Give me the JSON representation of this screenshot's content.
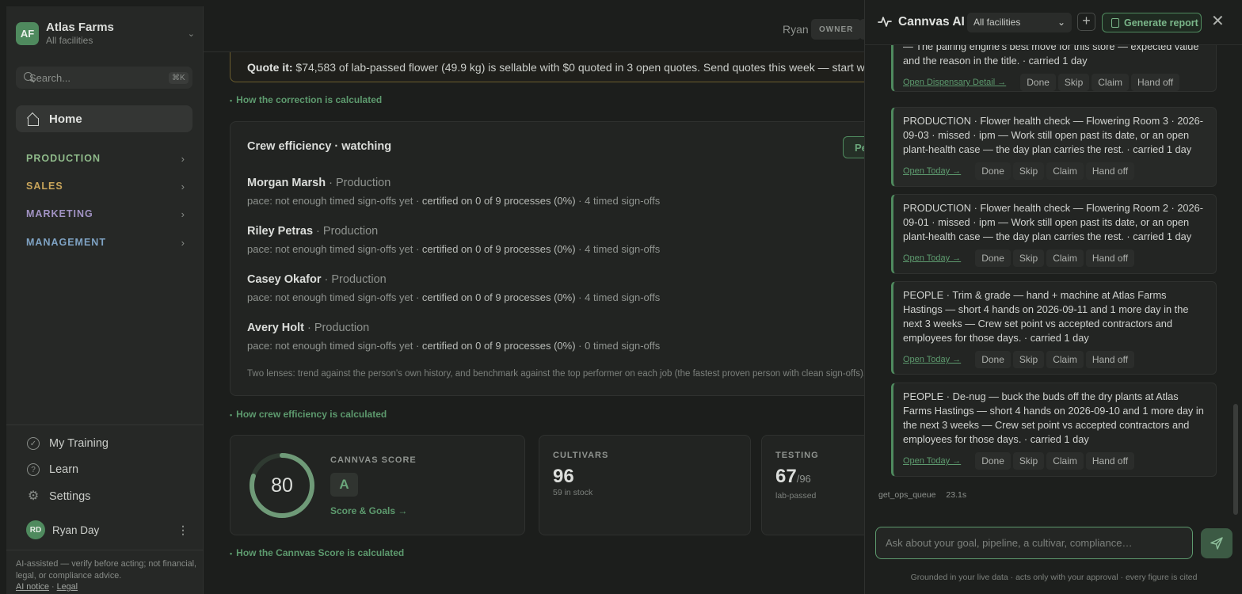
{
  "sidebar": {
    "org": {
      "initials": "AF",
      "name": "Atlas Farms",
      "subtitle": "All facilities"
    },
    "search": {
      "placeholder": "Search...",
      "shortcut": "⌘K"
    },
    "home_label": "Home",
    "sections": [
      {
        "label": "PRODUCTION",
        "color": "#8fba8a"
      },
      {
        "label": "SALES",
        "color": "#c9a55a"
      },
      {
        "label": "MARKETING",
        "color": "#a293c4"
      },
      {
        "label": "MANAGEMENT",
        "color": "#7fa3c4"
      }
    ],
    "bottom": {
      "training": "My Training",
      "learn": "Learn",
      "settings": "Settings"
    },
    "user": {
      "initials": "RD",
      "name": "Ryan Day"
    },
    "disclaimer": "AI-assisted — verify before acting; not financial, legal, or compliance advice.",
    "links": {
      "ai_notice": "AI notice",
      "sep": "·",
      "legal": "Legal"
    }
  },
  "topbar": {
    "user": "Ryan",
    "role": "OWNER"
  },
  "quote": {
    "lead": "Quote it:",
    "text": " $74,583 of lab-passed flower (49.9 kg) is sellable with $0 quoted in 3 open quotes. Send quotes this week — start with t"
  },
  "links": {
    "correction": "How the correction is calculated",
    "crew": "How crew efficiency is calculated",
    "score": "How the Cannvas Score is calculated"
  },
  "crew": {
    "title": "Crew efficiency · watching",
    "button": "Pe",
    "people": [
      {
        "name": "Morgan Marsh",
        "dept": " · Production",
        "pace": "pace: not enough timed sign-offs yet · ",
        "cert": "certified on 0 of 9 processes (0%)",
        "signoffs": " · 4 timed sign-offs"
      },
      {
        "name": "Riley Petras",
        "dept": " · Production",
        "pace": "pace: not enough timed sign-offs yet · ",
        "cert": "certified on 0 of 9 processes (0%)",
        "signoffs": " · 4 timed sign-offs"
      },
      {
        "name": "Casey Okafor",
        "dept": " · Production",
        "pace": "pace: not enough timed sign-offs yet · ",
        "cert": "certified on 0 of 9 processes (0%)",
        "signoffs": " · 4 timed sign-offs"
      },
      {
        "name": "Avery Holt",
        "dept": " · Production",
        "pace": "pace: not enough timed sign-offs yet · ",
        "cert": "certified on 0 of 9 processes (0%)",
        "signoffs": " · 0 timed sign-offs"
      }
    ],
    "note": "Two lenses: trend against the person's own history, and benchmark against the top performer on each job (the fastest proven person with clean sign-offs)."
  },
  "score_card": {
    "value": 80,
    "progress": 0.8,
    "label": "CANNVAS SCORE",
    "grade": "A",
    "goals_link": "Score & Goals →"
  },
  "cultivars_card": {
    "label": "CULTIVARS",
    "value": "96",
    "sub": "59 in stock"
  },
  "testing_card": {
    "label": "TESTING",
    "value": "67",
    "of": "/96",
    "sub": "lab-passed"
  },
  "panel": {
    "title": "Cannvas AI",
    "facility": "All facilities",
    "generate": "Generate report",
    "items": [
      {
        "text": "— The pairing engine's best move for this store — expected value and the reason in the title. · carried 1 day",
        "link": "Open Dispensary Detail →"
      },
      {
        "text": "PRODUCTION · Flower health check — Flowering Room 3 · 2026-09-03 · missed · ipm — Work still open past its date, or an open plant-health case — the day plan carries the rest. · carried 1 day",
        "link": "Open Today →"
      },
      {
        "text": "PRODUCTION · Flower health check — Flowering Room 2 · 2026-09-01 · missed · ipm — Work still open past its date, or an open plant-health case — the day plan carries the rest. · carried 1 day",
        "link": "Open Today →"
      },
      {
        "text": "PEOPLE · Trim & grade — hand + machine at Atlas Farms Hastings — short 4 hands on 2026-09-11 and 1 more day in the next 3 weeks — Crew set point vs accepted contractors and employees for those days. · carried 1 day",
        "link": "Open Today →"
      },
      {
        "text": "PEOPLE · De-nug — buck the buds off the dry plants at Atlas Farms Hastings — short 4 hands on 2026-09-10 and 1 more day in the next 3 weeks — Crew set point vs accepted contractors and employees for those days. · carried 1 day",
        "link": "Open Today →"
      }
    ],
    "actions": {
      "done": "Done",
      "skip": "Skip",
      "claim": "Claim",
      "handoff": "Hand off"
    },
    "tool": {
      "name": "get_ops_queue",
      "time": "23.1s"
    },
    "composer_placeholder": "Ask about your goal, pipeline, a cultivar, compliance…",
    "footnote": "Grounded in your live data · acts only with your approval · every figure is cited"
  }
}
